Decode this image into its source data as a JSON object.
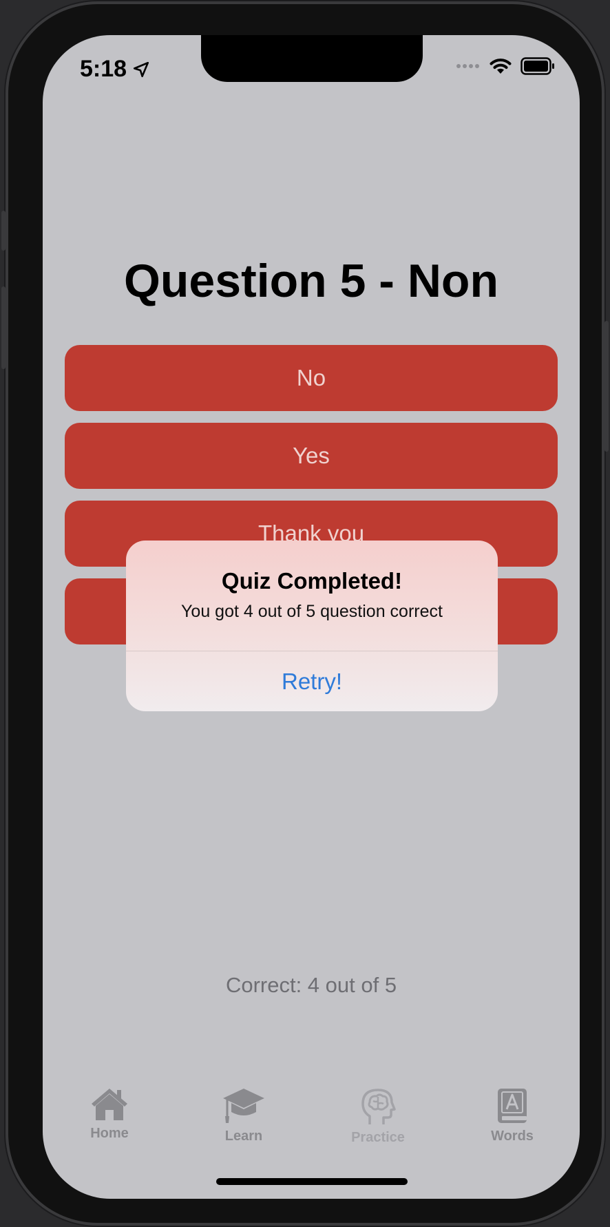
{
  "status_bar": {
    "time": "5:18"
  },
  "quiz": {
    "question_title": "Question 5 - Non",
    "answers": [
      "No",
      "Yes",
      "Thank you",
      ""
    ],
    "correct_text": "Correct: 4 out of 5"
  },
  "alert": {
    "title": "Quiz Completed!",
    "message": "You got 4 out of 5 question correct",
    "action_label": "Retry!"
  },
  "tabbar": {
    "items": [
      {
        "label": "Home",
        "icon": "house-icon"
      },
      {
        "label": "Learn",
        "icon": "graduation-cap-icon"
      },
      {
        "label": "Practice",
        "icon": "brain-head-icon"
      },
      {
        "label": "Words",
        "icon": "dictionary-book-icon"
      }
    ]
  },
  "colors": {
    "screen_background": "#c3c3c7",
    "answer_button": "#be3b31",
    "alert_action": "#2f7bd9",
    "tab_tint": "#8a8a8e"
  }
}
